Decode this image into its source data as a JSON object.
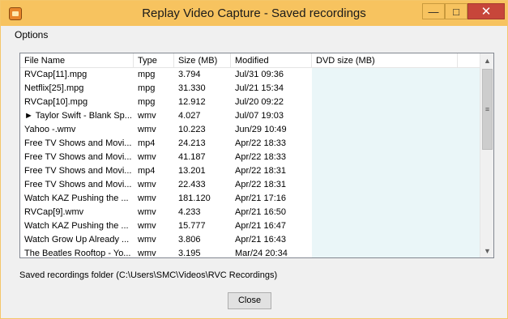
{
  "window": {
    "title": "Replay Video Capture - Saved recordings",
    "controls": {
      "minimize": "—",
      "maximize": "□",
      "close": "✕"
    }
  },
  "menu": {
    "options": "Options"
  },
  "list": {
    "columns": [
      "File Name",
      "Type",
      "Size (MB)",
      "Modified",
      "DVD size (MB)"
    ],
    "rows": [
      {
        "name": "RVCap[11].mpg",
        "type": "mpg",
        "size": "3.794",
        "modified": "Jul/31 09:36",
        "dvd": ""
      },
      {
        "name": "Netflix[25].mpg",
        "type": "mpg",
        "size": "31.330",
        "modified": "Jul/21 15:34",
        "dvd": ""
      },
      {
        "name": "RVCap[10].mpg",
        "type": "mpg",
        "size": "12.912",
        "modified": "Jul/20 09:22",
        "dvd": ""
      },
      {
        "name": "► Taylor Swift - Blank Sp...",
        "type": "wmv",
        "size": "4.027",
        "modified": "Jul/07 19:03",
        "dvd": ""
      },
      {
        "name": "Yahoo -.wmv",
        "type": "wmv",
        "size": "10.223",
        "modified": "Jun/29 10:49",
        "dvd": ""
      },
      {
        "name": "Free TV Shows and Movi...",
        "type": "mp4",
        "size": "24.213",
        "modified": "Apr/22 18:33",
        "dvd": ""
      },
      {
        "name": "Free TV Shows and Movi...",
        "type": "wmv",
        "size": "41.187",
        "modified": "Apr/22 18:33",
        "dvd": ""
      },
      {
        "name": "Free TV Shows and Movi...",
        "type": "mp4",
        "size": "13.201",
        "modified": "Apr/22 18:31",
        "dvd": ""
      },
      {
        "name": "Free TV Shows and Movi...",
        "type": "wmv",
        "size": "22.433",
        "modified": "Apr/22 18:31",
        "dvd": ""
      },
      {
        "name": "Watch KAZ Pushing the ...",
        "type": "wmv",
        "size": "181.120",
        "modified": "Apr/21 17:16",
        "dvd": ""
      },
      {
        "name": "RVCap[9].wmv",
        "type": "wmv",
        "size": "4.233",
        "modified": "Apr/21 16:50",
        "dvd": ""
      },
      {
        "name": "Watch KAZ Pushing the ...",
        "type": "wmv",
        "size": "15.777",
        "modified": "Apr/21 16:47",
        "dvd": ""
      },
      {
        "name": "Watch Grow Up Already ...",
        "type": "wmv",
        "size": "3.806",
        "modified": "Apr/21 16:43",
        "dvd": ""
      },
      {
        "name": "The Beatles Rooftop - Yo...",
        "type": "wmv",
        "size": "3.195",
        "modified": "Mar/24 20:34",
        "dvd": ""
      }
    ]
  },
  "scrollbar": {
    "up": "▲",
    "down": "▼",
    "grip": "≡"
  },
  "footer": {
    "folder_label": "Saved recordings folder (C:\\Users\\SMC\\Videos\\RVC Recordings)",
    "close_button": "Close"
  },
  "colors": {
    "titlebar": "#f7c35f",
    "window_bg": "#f0f0f0",
    "dvd_column_bg": "#eaf6f8",
    "close_control": "#c7463a"
  },
  "icons": {
    "app": "replay-video-capture-app-icon"
  }
}
